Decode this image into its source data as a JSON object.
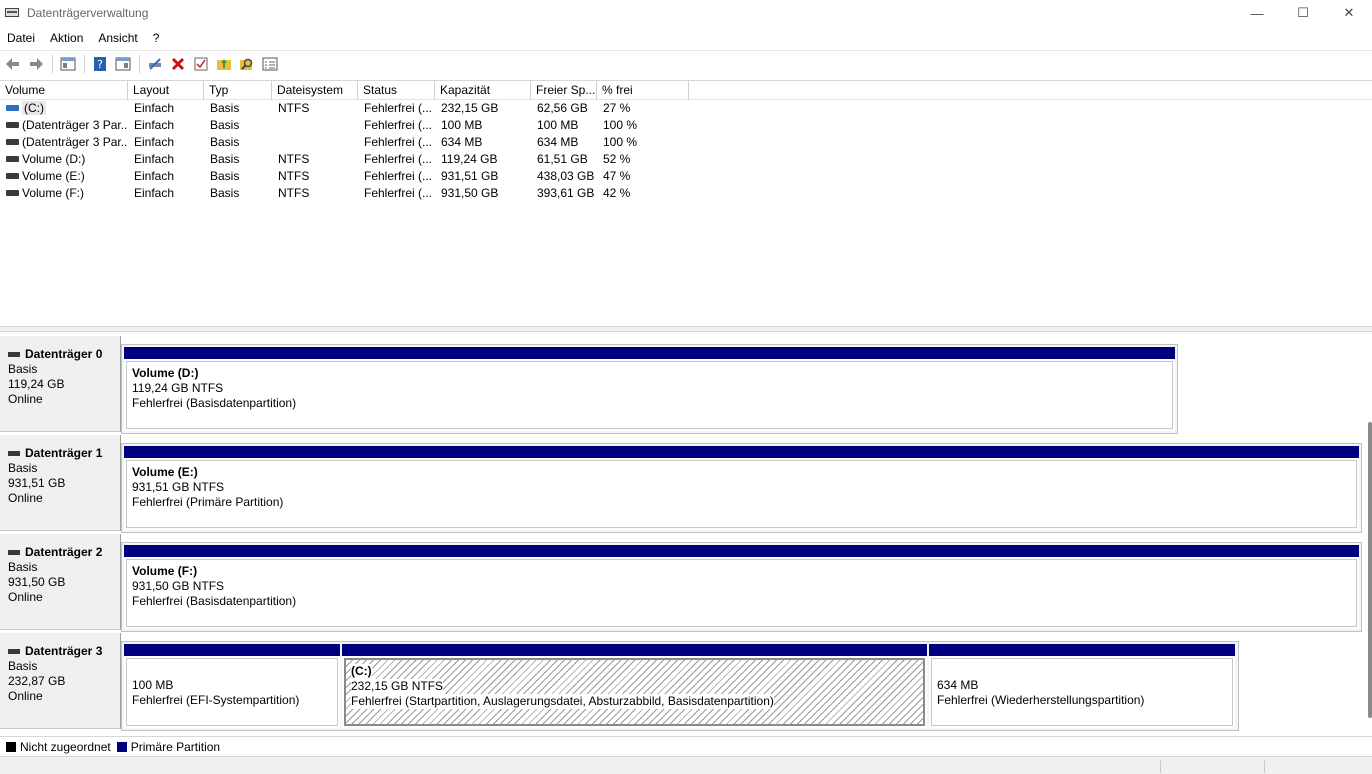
{
  "window": {
    "title": "Datenträgerverwaltung",
    "minimize": "—",
    "maximize": "☐",
    "close": "✕"
  },
  "menu": [
    "Datei",
    "Aktion",
    "Ansicht",
    "?"
  ],
  "toolbar": {
    "icons": [
      "back-arrow-icon",
      "forward-arrow-icon",
      "console-tree-icon",
      "help-icon",
      "properties-icon",
      "connect-drive-icon",
      "delete-icon",
      "check-icon",
      "folder-up-icon",
      "search-icon",
      "settings-list-icon"
    ]
  },
  "volume_list": {
    "headers": [
      "Volume",
      "Layout",
      "Typ",
      "Dateisystem",
      "Status",
      "Kapazität",
      "Freier Sp...",
      "% frei"
    ],
    "rows": [
      [
        "(C:)",
        "Einfach",
        "Basis",
        "NTFS",
        "Fehlerfrei (...",
        "232,15 GB",
        "62,56 GB",
        "27 %"
      ],
      [
        "(Datenträger 3 Par...",
        "Einfach",
        "Basis",
        "",
        "Fehlerfrei (...",
        "100 MB",
        "100 MB",
        "100 %"
      ],
      [
        "(Datenträger 3 Par...",
        "Einfach",
        "Basis",
        "",
        "Fehlerfrei (...",
        "634 MB",
        "634 MB",
        "100 %"
      ],
      [
        "Volume (D:)",
        "Einfach",
        "Basis",
        "NTFS",
        "Fehlerfrei (...",
        "119,24 GB",
        "61,51 GB",
        "52 %"
      ],
      [
        "Volume (E:)",
        "Einfach",
        "Basis",
        "NTFS",
        "Fehlerfrei (...",
        "931,51 GB",
        "438,03 GB",
        "47 %"
      ],
      [
        "Volume (F:)",
        "Einfach",
        "Basis",
        "NTFS",
        "Fehlerfrei (...",
        "931,50 GB",
        "393,61 GB",
        "42 %"
      ]
    ]
  },
  "disks": [
    {
      "name": "Datenträger 0",
      "type": "Basis",
      "size": "119,24 GB",
      "state": "Online",
      "partitions": [
        {
          "title": "Volume  (D:)",
          "size": "119,24 GB NTFS",
          "status": "Fehlerfrei (Basisdatenpartition)"
        }
      ]
    },
    {
      "name": "Datenträger 1",
      "type": "Basis",
      "size": "931,51 GB",
      "state": "Online",
      "partitions": [
        {
          "title": "Volume  (E:)",
          "size": "931,51 GB NTFS",
          "status": "Fehlerfrei (Primäre Partition)"
        }
      ]
    },
    {
      "name": "Datenträger 2",
      "type": "Basis",
      "size": "931,50 GB",
      "state": "Online",
      "partitions": [
        {
          "title": "Volume  (F:)",
          "size": "931,50 GB NTFS",
          "status": "Fehlerfrei (Basisdatenpartition)"
        }
      ]
    },
    {
      "name": "Datenträger 3",
      "type": "Basis",
      "size": "232,87 GB",
      "state": "Online",
      "partitions": [
        {
          "title": "",
          "size": "100 MB",
          "status": "Fehlerfrei (EFI-Systempartition)"
        },
        {
          "title": " (C:)",
          "size": "232,15 GB NTFS",
          "status": "Fehlerfrei (Startpartition, Auslagerungsdatei, Absturzabbild, Basisdatenpartition)"
        },
        {
          "title": "",
          "size": "634 MB",
          "status": "Fehlerfrei (Wiederherstellungspartition)"
        }
      ]
    }
  ],
  "legend": [
    {
      "label": "Nicht zugeordnet",
      "color": "#000000"
    },
    {
      "label": "Primäre Partition",
      "color": "#00007f"
    }
  ],
  "colors": {
    "primary_partition_bar": "#00007f"
  }
}
